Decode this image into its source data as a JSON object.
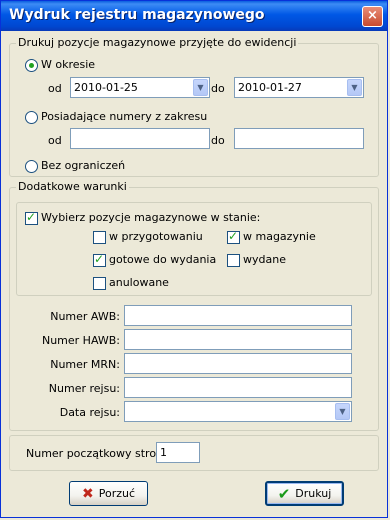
{
  "window": {
    "title": "Wydruk rejestru magazynowego",
    "close_glyph": "×"
  },
  "range_group": {
    "legend": "Drukuj pozycje magazynowe przyjęte do ewidencji",
    "opt_period": {
      "label": "W okresie",
      "selected": true
    },
    "from_label": "od",
    "to_label": "do",
    "date_from": "2010-01-25",
    "date_to": "2010-01-27",
    "opt_numbers": {
      "label": "Posiadające numery z zakresu",
      "selected": false
    },
    "num_from_label": "od",
    "num_to_label": "do",
    "num_from": "",
    "num_to": "",
    "opt_none": {
      "label": "Bez ograniczeń",
      "selected": false
    }
  },
  "conditions_group": {
    "legend": "Dodatkowe warunki",
    "state_filter": {
      "label": "Wybierz pozycje magazynowe w stanie:",
      "checked": true
    },
    "states": {
      "przygotowaniu": {
        "label": "w przygotowaniu",
        "checked": false
      },
      "magazynie": {
        "label": "w magazynie",
        "checked": true
      },
      "gotowe": {
        "label": "gotowe do wydania",
        "checked": true
      },
      "wydane": {
        "label": "wydane",
        "checked": false
      },
      "anulowane": {
        "label": "anulowane",
        "checked": false
      }
    }
  },
  "fields": {
    "awb": {
      "label": "Numer AWB:",
      "value": ""
    },
    "hawb": {
      "label": "Numer HAWB:",
      "value": ""
    },
    "mrn": {
      "label": "Numer MRN:",
      "value": ""
    },
    "rejs": {
      "label": "Numer rejsu:",
      "value": ""
    },
    "data_rejsu": {
      "label": "Data rejsu:",
      "value": ""
    }
  },
  "page_start": {
    "label": "Numer początkowy strony:",
    "value": "1"
  },
  "buttons": {
    "cancel": "Porzuć",
    "print": "Drukuj"
  },
  "icons": {
    "check": "✓",
    "radio_dot": "●",
    "dropdown": "▼",
    "cancel": "✖",
    "ok": "✔"
  },
  "colors": {
    "titlebar": "#0058E6",
    "face": "#ECE9D8",
    "accent_green": "#21A121",
    "field_border": "#7F9DB9"
  }
}
